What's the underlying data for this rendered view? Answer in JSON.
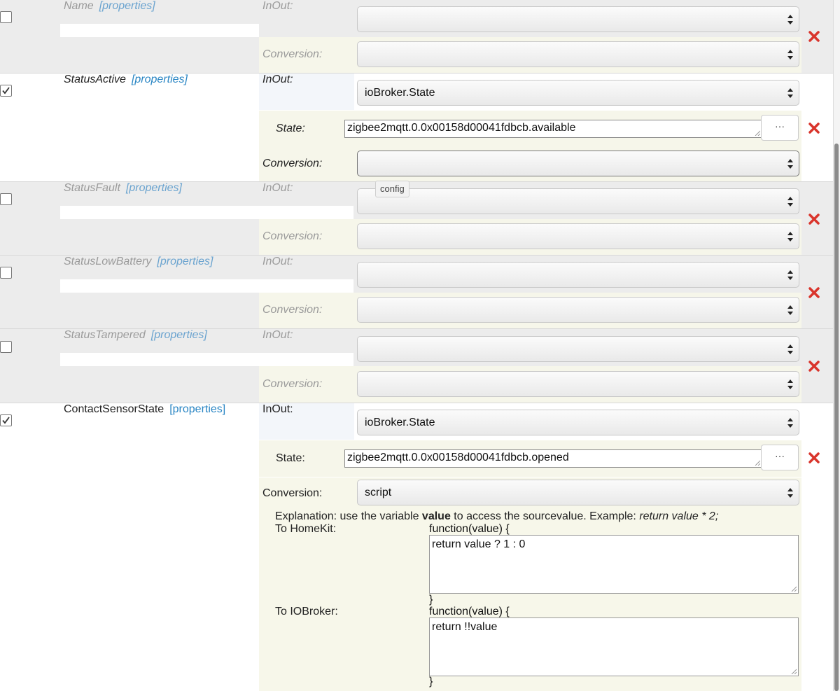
{
  "labels": {
    "inout": "InOut:",
    "conversion": "Conversion:",
    "state": "State:",
    "properties": "[properties]",
    "dots_button": "···",
    "tooltip": "config"
  },
  "characteristics": [
    {
      "name": "Name",
      "enabled": false
    },
    {
      "name": "StatusActive",
      "enabled": true,
      "inout_value": "ioBroker.State",
      "state_value": "zigbee2mqtt.0.0x00158d00041fdbcb.available",
      "conversion_value": ""
    },
    {
      "name": "StatusFault",
      "enabled": false
    },
    {
      "name": "StatusLowBattery",
      "enabled": false
    },
    {
      "name": "StatusTampered",
      "enabled": false
    },
    {
      "name": "ContactSensorState",
      "enabled": true,
      "inout_value": "ioBroker.State",
      "state_value": "zigbee2mqtt.0.0x00158d00041fdbcb.opened",
      "conversion_value": "script"
    }
  ],
  "script": {
    "explanation_prefix": "Explanation: use the variable ",
    "explanation_bold": "value",
    "explanation_mid": " to access the sourcevalue. Example: ",
    "explanation_example": "return value * 2;",
    "to_homekit_label": "To HomeKit:",
    "to_iobroker_label": "To IOBroker:",
    "func_open": "function(value) {",
    "func_close": "}",
    "homekit_code": "return value ? 1 : 0",
    "iobroker_code": "return !!value"
  },
  "colors": {
    "remove_icon": "#d9342b",
    "link": "#2a86c4"
  }
}
